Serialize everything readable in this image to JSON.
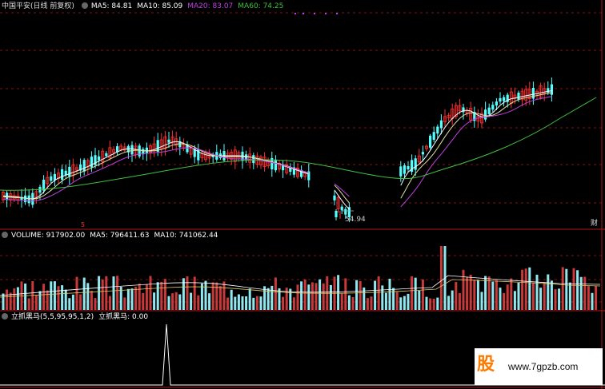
{
  "main_panel": {
    "stock_name": "中国平安(日线 前复权)",
    "ma": [
      {
        "label": "MA5: 84.81",
        "color": "#ffffff"
      },
      {
        "label": "MA10: 85.09",
        "color": "#ffffff"
      },
      {
        "label": "MA20: 83.07",
        "color": "#c040e0"
      },
      {
        "label": "MA60: 74.25",
        "color": "#40c040"
      }
    ],
    "low_label": "54.94",
    "right_marker": "财",
    "left_marker": "5"
  },
  "volume_panel": {
    "title": "VOLUME: 917902.00",
    "ma5": "MA5: 796411.63",
    "ma10": "MA10: 741062.44"
  },
  "indicator_panel": {
    "title": "立抓黑马(5,5,95,95,1,2)",
    "value": "立抓黑马: 0.00"
  },
  "watermark": {
    "logo": "股",
    "url": "www.7gpzb.com"
  },
  "colors": {
    "up": "#ff3030",
    "down": "#54ffff",
    "ma5": "#ffffff",
    "ma20": "#c040e0",
    "ma60": "#40c040",
    "grid": "#8a1010"
  },
  "chart_data": {
    "type": "candlestick",
    "series": [
      "MA5",
      "MA10",
      "MA20",
      "MA60",
      "VOLUME"
    ]
  }
}
